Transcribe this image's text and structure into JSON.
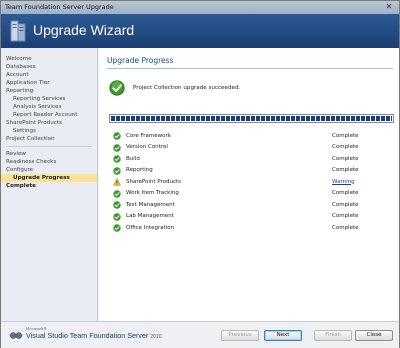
{
  "window": {
    "title": "Team Foundation Server Upgrade",
    "close_glyph": "✕"
  },
  "banner": {
    "title": "Upgrade Wizard"
  },
  "sidebar": {
    "items": [
      {
        "label": "Welcome"
      },
      {
        "label": "Databases"
      },
      {
        "label": "Account"
      },
      {
        "label": "Application Tier"
      },
      {
        "label": "Reporting"
      },
      {
        "label": "Reporting Services"
      },
      {
        "label": "Analysis Services"
      },
      {
        "label": "Report Reader Account"
      },
      {
        "label": "SharePoint Products"
      },
      {
        "label": "Settings"
      },
      {
        "label": "Project Collection"
      },
      {
        "label": "Review"
      },
      {
        "label": "Readiness Checks"
      },
      {
        "label": "Configure"
      },
      {
        "label": "Upgrade Progress"
      },
      {
        "label": "Complete"
      }
    ]
  },
  "main": {
    "title": "Upgrade Progress",
    "success_message": "Project Collection upgrade succeeded.",
    "progress_percent": 100,
    "rows": [
      {
        "name": "Core Framework",
        "status": "Complete",
        "icon": "success-check"
      },
      {
        "name": "Version Control",
        "status": "Complete",
        "icon": "success-check"
      },
      {
        "name": "Build",
        "status": "Complete",
        "icon": "success-check"
      },
      {
        "name": "Reporting",
        "status": "Complete",
        "icon": "success-check"
      },
      {
        "name": "SharePoint Products",
        "status": "Warning",
        "icon": "warning-triangle"
      },
      {
        "name": "Work Item Tracking",
        "status": "Complete",
        "icon": "success-check"
      },
      {
        "name": "Test Management",
        "status": "Complete",
        "icon": "success-check"
      },
      {
        "name": "Lab Management",
        "status": "Complete",
        "icon": "success-check"
      },
      {
        "name": "Office Integration",
        "status": "Complete",
        "icon": "success-check"
      }
    ]
  },
  "footer": {
    "logo_small": "Microsoft®",
    "logo_text": "Visual Studio Team Foundation Server",
    "logo_year": "2010",
    "buttons": {
      "previous": "Previous",
      "next": "Next",
      "finish": "Finish",
      "close": "Close"
    }
  },
  "colors": {
    "banner": "#1c3f73",
    "active_nav": "#f7e49a",
    "success_green": "#3a9a2a",
    "warning_yellow": "#f2c230",
    "link_blue": "#1a3e9a"
  }
}
